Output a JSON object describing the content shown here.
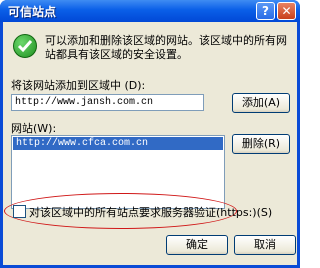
{
  "window": {
    "title": "可信站点",
    "help_button": "?",
    "close_button": "✕"
  },
  "description": "可以添加和删除该区域的网站。该区域中的所有网站都具有该区域的安全设置。",
  "add_site": {
    "label": "将该网站添加到区域中 (D):",
    "value": "http://www.jansh.com.cn",
    "add_button": "添加(A)"
  },
  "sites": {
    "label": "网站(W):",
    "items": [
      "http://www.cfca.com.cn"
    ],
    "remove_button": "删除(R)"
  },
  "https_option": {
    "label": "对该区域中的所有站点要求服务器验证(https:)(S)",
    "checked": false
  },
  "buttons": {
    "ok": "确定",
    "cancel": "取消"
  },
  "colors": {
    "titlebar": "#0a5fe8",
    "dialog_bg": "#ece9d8",
    "selection": "#316ac5",
    "highlight_ring": "#d01818"
  }
}
